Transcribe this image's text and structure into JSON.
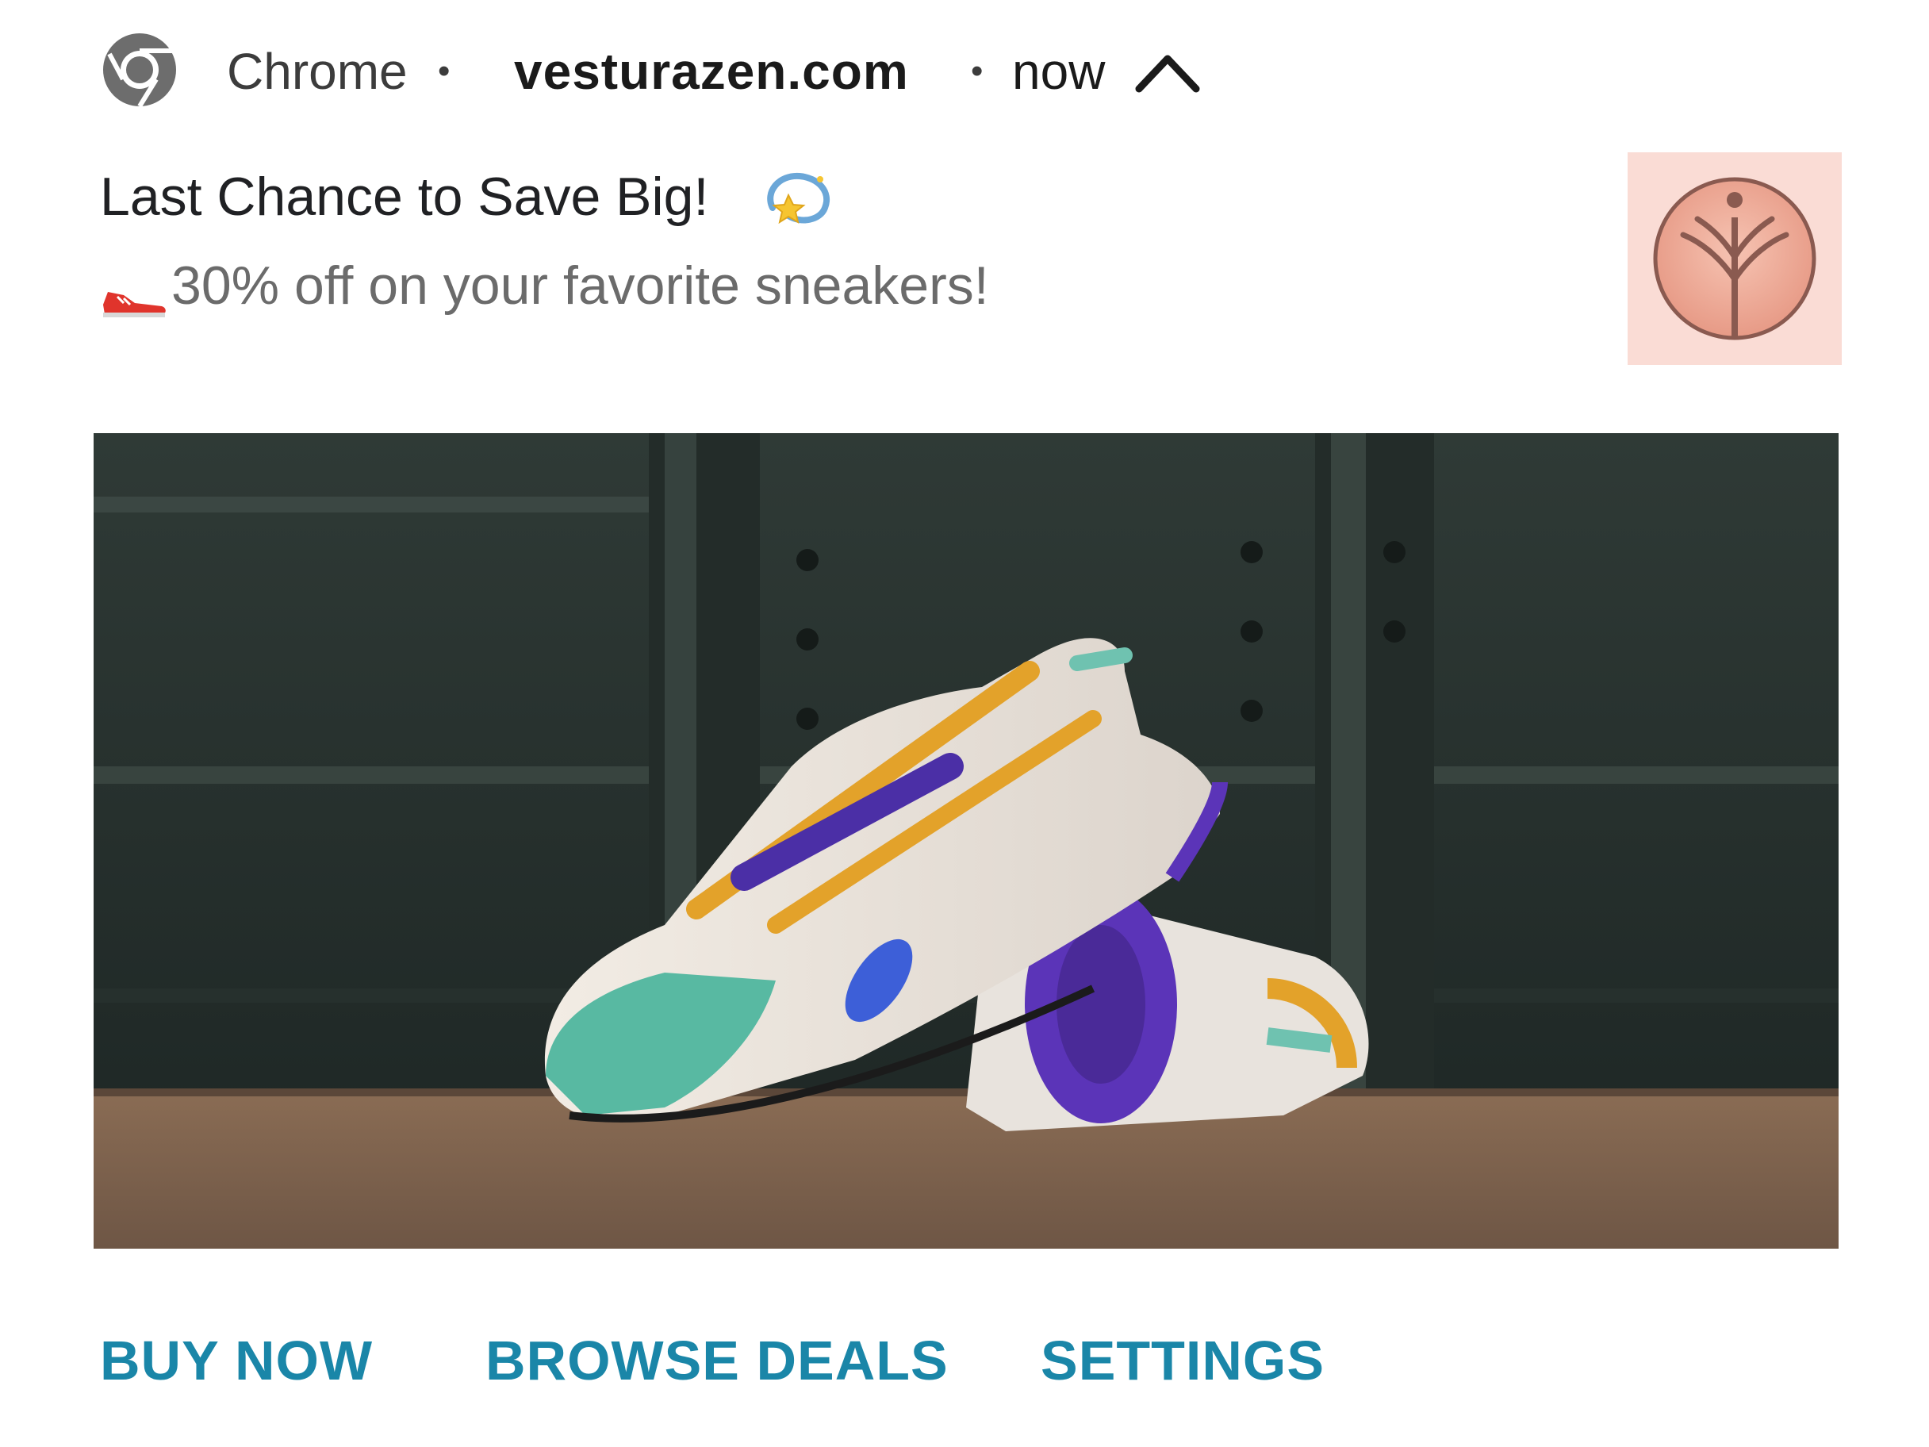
{
  "notification": {
    "app_name": "Chrome",
    "separator": "•",
    "domain": "vesturazen.com",
    "time": "now",
    "title": "Last Chance to Save Big!",
    "body": "30% off on your favorite sneakers!",
    "icons": {
      "app": "chrome-icon",
      "expand": "chevron-up-icon",
      "title_emoji": "dizzy-star-emoji",
      "body_emoji": "sneaker-emoji",
      "brand": "vesturazen-logo"
    },
    "image": "sneakers-photo"
  },
  "actions": {
    "buy_now": "BUY NOW",
    "browse_deals": "BROWSE DEALS",
    "settings": "SETTINGS"
  },
  "colors": {
    "action_text": "#1a86a8",
    "title_text": "#202124",
    "body_text": "#6b6b6b",
    "brand_bg": "#fadcd5",
    "brand_logo": "#a8655a"
  }
}
